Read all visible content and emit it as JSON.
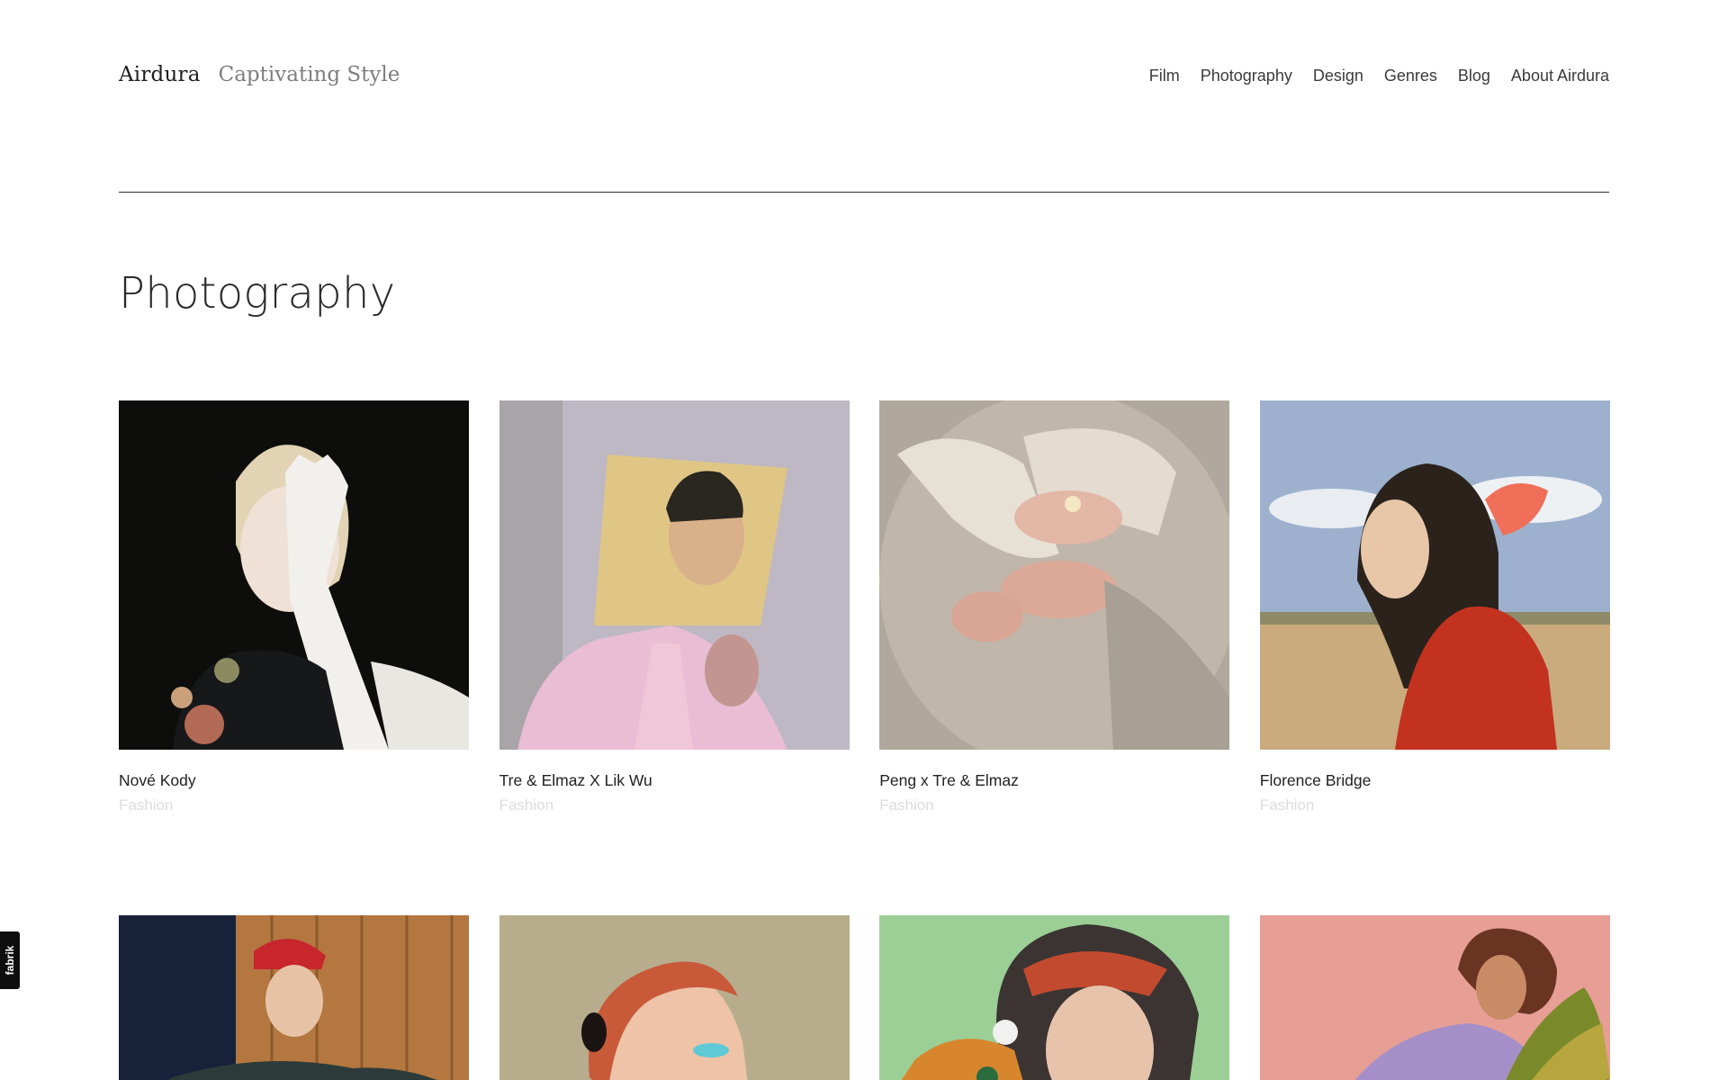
{
  "brand": {
    "name": "Airdura",
    "tagline": "Captivating Style"
  },
  "nav": {
    "items": [
      "Film",
      "Photography",
      "Design",
      "Genres",
      "Blog",
      "About Airdura"
    ]
  },
  "page": {
    "title": "Photography"
  },
  "projects": [
    {
      "title": "Nové Kody",
      "category": "Fashion"
    },
    {
      "title": "Tre & Elmaz X Lik Wu",
      "category": "Fashion"
    },
    {
      "title": "Peng x Tre & Elmaz",
      "category": "Fashion"
    },
    {
      "title": "Florence Bridge",
      "category": "Fashion"
    }
  ],
  "badge": {
    "label": "fabrik"
  },
  "colors": {
    "background": "#ffffff",
    "text": "#1f1f1f",
    "muted": "#7e7e7e",
    "category": "#dcdcdc",
    "divider": "#2a2a2a"
  }
}
